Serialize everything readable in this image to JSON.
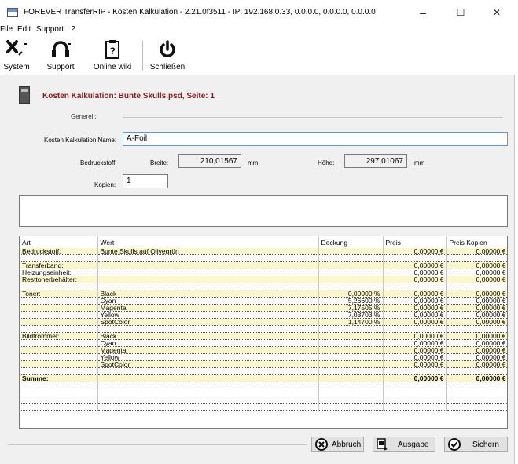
{
  "window": {
    "title": "FOREVER TransferRIP - Kosten Kalkulation - 2.21.0f3511 - IP: 192.168.0.33, 0.0.0.0, 0.0.0.0, 0.0.0.0",
    "minimize": "–",
    "maximize": "☐",
    "close": "✕"
  },
  "menu": {
    "file": "File",
    "edit": "Edit",
    "support": "Support",
    "help": "?"
  },
  "toolbar": {
    "system": "System",
    "support": "Support",
    "wiki": "Online wiki",
    "close": "Schließen"
  },
  "heading": "Kosten Kalkulation: Bunte Skulls.psd, Seite: 1",
  "form": {
    "group": "Generell:",
    "name_label": "Kosten Kalkulation Name:",
    "name_value": "A-Foil",
    "bedruckstoff_label": "Bedruckstoff:",
    "breite_label": "Breite:",
    "breite_value": "210,01567",
    "unit1": "mm",
    "hoehe_label": "Höhe:",
    "hoehe_value": "297,01067",
    "unit2": "mm",
    "kopien_label": "Kopien:",
    "kopien_value": "1"
  },
  "table": {
    "headers": [
      "Art",
      "Wert",
      "Deckung",
      "Preis",
      "Preis Kopien"
    ],
    "rows": [
      {
        "art": "Bedruckstoff:",
        "wert": "Bunte Skulls auf Olivegrün",
        "deckung": "",
        "preis": "0,00000 €",
        "kopien": "0,00000 €",
        "hl": true
      },
      {
        "art": "",
        "wert": "",
        "deckung": "",
        "preis": "",
        "kopien": "",
        "hl": false
      },
      {
        "art": "Transferband:",
        "wert": "",
        "deckung": "",
        "preis": "0,00000 €",
        "kopien": "0,00000 €",
        "hl": true
      },
      {
        "art": "Heizungseinheit:",
        "wert": "",
        "deckung": "",
        "preis": "0,00000 €",
        "kopien": "0,00000 €",
        "hl": false
      },
      {
        "art": "Resttonerbehälter:",
        "wert": "",
        "deckung": "",
        "preis": "0,00000 €",
        "kopien": "0,00000 €",
        "hl": true
      },
      {
        "art": "",
        "wert": "",
        "deckung": "",
        "preis": "",
        "kopien": "",
        "hl": false
      },
      {
        "art": "Toner:",
        "wert": "Black",
        "deckung": "0,00000 %",
        "preis": "0,00000 €",
        "kopien": "0,00000 €",
        "hl": true
      },
      {
        "art": "",
        "wert": "Cyan",
        "deckung": "5,26600 %",
        "preis": "0,00000 €",
        "kopien": "0,00000 €",
        "hl": false
      },
      {
        "art": "",
        "wert": "Magenta",
        "deckung": "7,17505 %",
        "preis": "0,00000 €",
        "kopien": "0,00000 €",
        "hl": true
      },
      {
        "art": "",
        "wert": "Yellow",
        "deckung": "7,03703 %",
        "preis": "0,00000 €",
        "kopien": "0,00000 €",
        "hl": false
      },
      {
        "art": "",
        "wert": "SpotColor",
        "deckung": "1,14700 %",
        "preis": "0,00000 €",
        "kopien": "0,00000 €",
        "hl": true
      },
      {
        "art": "",
        "wert": "",
        "deckung": "",
        "preis": "",
        "kopien": "",
        "hl": false
      },
      {
        "art": "Bildtrommel:",
        "wert": "Black",
        "deckung": "",
        "preis": "0,00000 €",
        "kopien": "0,00000 €",
        "hl": true
      },
      {
        "art": "",
        "wert": "Cyan",
        "deckung": "",
        "preis": "0,00000 €",
        "kopien": "0,00000 €",
        "hl": false
      },
      {
        "art": "",
        "wert": "Magenta",
        "deckung": "",
        "preis": "0,00000 €",
        "kopien": "0,00000 €",
        "hl": true
      },
      {
        "art": "",
        "wert": "Yellow",
        "deckung": "",
        "preis": "0,00000 €",
        "kopien": "0,00000 €",
        "hl": false
      },
      {
        "art": "",
        "wert": "SpotColor",
        "deckung": "",
        "preis": "0,00000 €",
        "kopien": "0,00000 €",
        "hl": true
      },
      {
        "art": "",
        "wert": "",
        "deckung": "",
        "preis": "",
        "kopien": "",
        "hl": false
      },
      {
        "art": "Summe:",
        "wert": "",
        "deckung": "",
        "preis": "0,00000 €",
        "kopien": "0,00000 €",
        "hl": true,
        "bold": true
      },
      {
        "art": "",
        "wert": "",
        "deckung": "",
        "preis": "",
        "kopien": "",
        "hl": false
      },
      {
        "art": "",
        "wert": "",
        "deckung": "",
        "preis": "",
        "kopien": "",
        "hl": false
      },
      {
        "art": "",
        "wert": "",
        "deckung": "",
        "preis": "",
        "kopien": "",
        "hl": false
      },
      {
        "art": "",
        "wert": "",
        "deckung": "",
        "preis": "",
        "kopien": "",
        "hl": false
      }
    ]
  },
  "buttons": {
    "abbruch": "Abbruch",
    "ausgabe": "Ausgabe",
    "sichern": "Sichern"
  },
  "colors": {
    "heading": "#8b1a1a",
    "highlight_row": "#fdf7cc",
    "focus_border": "#5b9bd5"
  }
}
